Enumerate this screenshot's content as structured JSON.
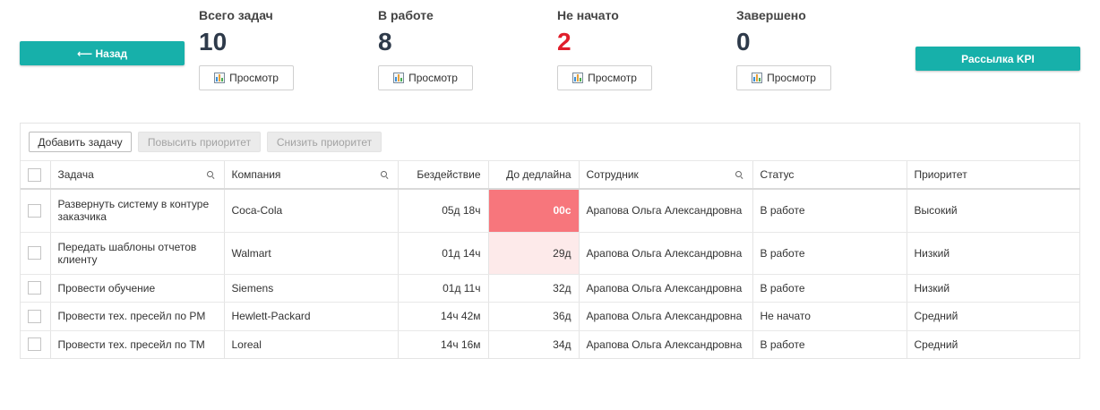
{
  "nav": {
    "back_label": "⟵ Назад",
    "kpi_label": "Рассылка KPI"
  },
  "stats": [
    {
      "label": "Всего задач",
      "value": "10",
      "view": "Просмотр"
    },
    {
      "label": "В работе",
      "value": "8",
      "view": "Просмотр"
    },
    {
      "label": "Не начато",
      "value": "2",
      "view": "Просмотр",
      "color": "#e01e2b"
    },
    {
      "label": "Завершено",
      "value": "0",
      "view": "Просмотр"
    }
  ],
  "toolbar": {
    "add": "Добавить задачу",
    "raise": "Повысить приоритет",
    "lower": "Снизить приоритет"
  },
  "columns": [
    "Задача",
    "Компания",
    "Бездействие",
    "До дедлайна",
    "Сотрудник",
    "Статус",
    "Приоритет"
  ],
  "rows": [
    {
      "task": "Развернуть систему в контуре заказчика",
      "company": "Coca-Cola",
      "idle": "05д 18ч",
      "deadline": "00с",
      "employee": "Арапова Ольга Александровна",
      "status": "В работе",
      "priority": "Высокий",
      "deadline_color": "#f7767c"
    },
    {
      "task": "Передать шаблоны отчетов клиенту",
      "company": "Walmart",
      "idle": "01д 14ч",
      "deadline": "29д",
      "employee": "Арапова Ольга Александровна",
      "status": "В работе",
      "priority": "Низкий",
      "deadline_color": "#fdeaea"
    },
    {
      "task": "Провести обучение",
      "company": "Siemens",
      "idle": "01д 11ч",
      "deadline": "32д",
      "employee": "Арапова Ольга Александровна",
      "status": "В работе",
      "priority": "Низкий"
    },
    {
      "task": "Провести тех. пресейл по PM",
      "company": "Hewlett-Packard",
      "idle": "14ч 42м",
      "deadline": "36д",
      "employee": "Арапова Ольга Александровна",
      "status": "Не начато",
      "priority": "Средний"
    },
    {
      "task": "Провести тех. пресейл по TM",
      "company": "Loreal",
      "idle": "14ч 16м",
      "deadline": "34д",
      "employee": "Арапова Ольга Александровна",
      "status": "В работе",
      "priority": "Средний"
    }
  ],
  "colors": {
    "accent": "#17b0aa",
    "danger": "#e01e2b"
  }
}
